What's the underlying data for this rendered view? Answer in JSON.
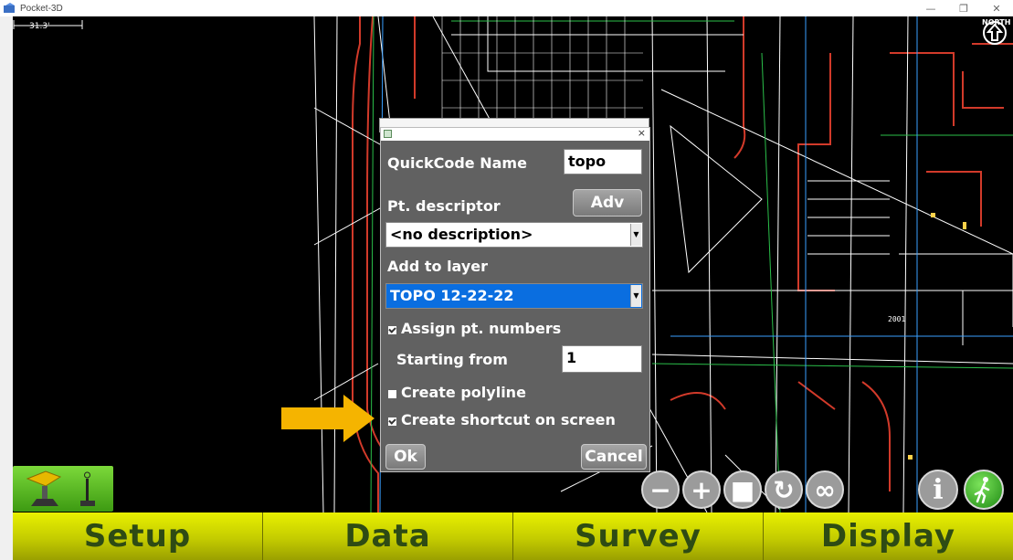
{
  "window": {
    "title": "Pocket-3D",
    "minimize": "—",
    "maximize": "❐",
    "close": "✕"
  },
  "map": {
    "scale_label": "31.3'",
    "north_label": "NORTH",
    "point_label": "2001"
  },
  "dialog": {
    "close": "×",
    "quickcode_name_label": "QuickCode Name",
    "quickcode_name_value": "topo",
    "pt_descriptor_label": "Pt. descriptor",
    "adv_button": "Adv",
    "description_select": "<no description>",
    "add_to_layer_label": "Add to layer",
    "layer_select": "TOPO 12-22-22",
    "assign_pt_numbers_label": "Assign pt. numbers",
    "assign_pt_numbers_checked": true,
    "starting_from_label": "Starting from",
    "starting_from_value": "1",
    "create_polyline_label": "Create polyline",
    "create_polyline_checked": false,
    "create_shortcut_label": "Create shortcut on screen",
    "create_shortcut_checked": true,
    "ok_button": "Ok",
    "cancel_button": "Cancel"
  },
  "zoom_controls": {
    "zoom_out": "−",
    "zoom_in": "+",
    "extents": "■",
    "refresh": "↻",
    "infinity": "∞"
  },
  "info_button": "i",
  "bottom_menu": [
    {
      "label": "Setup"
    },
    {
      "label": "Data"
    },
    {
      "label": "Survey"
    },
    {
      "label": "Display"
    }
  ],
  "colors": {
    "menu_yellow": "#d7df00",
    "dialog_bg": "#616161",
    "selected_blue": "#0a6ee0",
    "annotation_arrow": "#f5b400"
  }
}
